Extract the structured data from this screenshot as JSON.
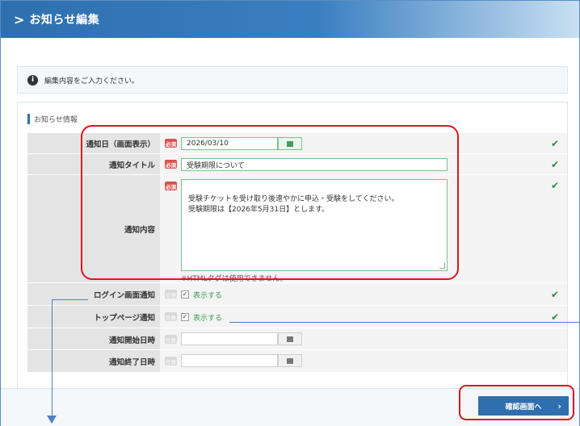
{
  "header": {
    "title": "お知らせ編集"
  },
  "notice": {
    "text": "編集内容をご入力ください。"
  },
  "section": {
    "title": "お知らせ情報"
  },
  "badges": {
    "required": "必須",
    "optional": "任意"
  },
  "form": {
    "notify_date": {
      "label": "通知日（画面表示）",
      "value": "2026/03/10"
    },
    "notify_title": {
      "label": "通知タイトル",
      "value": "受験期限について"
    },
    "notify_content": {
      "label": "通知内容",
      "value": "受験チケットを受け取り後速やかに申込・受験をしてください。\n受験期限は【2026年5月31日】とします。",
      "note": "※HTMLタグは使用できません。"
    },
    "login_notice": {
      "label": "ログイン画面通知",
      "checkbox_label": "表示する",
      "checked": true
    },
    "top_notice": {
      "label": "トップページ通知",
      "checkbox_label": "表示する",
      "checked": true
    },
    "start_date": {
      "label": "通知開始日時",
      "value": ""
    },
    "end_date": {
      "label": "通知終了日時",
      "value": ""
    }
  },
  "actions": {
    "confirm_label": "確認画面へ"
  },
  "icons": {
    "chevron": "chevron-right-icon",
    "info": "info-icon",
    "calendar": "calendar-icon",
    "check": "checkmark-icon",
    "arrow": "chevron-right-icon"
  },
  "colors": {
    "header": "#2f6fae",
    "required_badge": "#d9534f",
    "valid_check": "#2e8b3e",
    "annotation_red": "#e0141c",
    "annotation_blue": "#4f7fc0"
  }
}
